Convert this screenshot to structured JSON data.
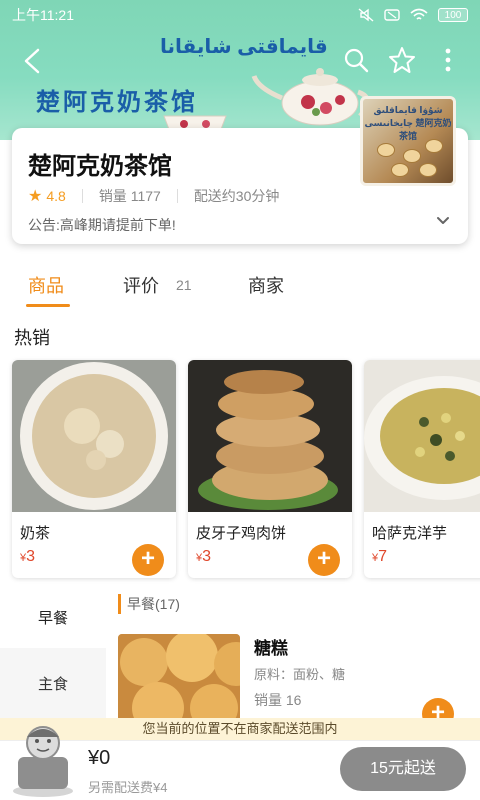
{
  "status_bar": {
    "time": "上午11:21",
    "battery": "100"
  },
  "banner": {
    "uyghur_title": "قايماقتى  شايقانا",
    "cn_title": "楚阿克奶茶馆",
    "thumb_text": "شۇۋا قايماقلىق چايخانىسى 楚阿克奶茶馆"
  },
  "shop": {
    "name": "楚阿克奶茶馆",
    "rating": "4.8",
    "sales": "销量 1177",
    "delivery": "配送约30分钟",
    "notice": "公告:高峰期请提前下单!"
  },
  "tabs": [
    {
      "label": "商品"
    },
    {
      "label": "评价",
      "count": "21"
    },
    {
      "label": "商家"
    }
  ],
  "hot": {
    "title": "热销",
    "items": [
      {
        "name": "奶茶",
        "currency": "¥",
        "price": "3"
      },
      {
        "name": "皮牙子鸡肉饼",
        "currency": "¥",
        "price": "3"
      },
      {
        "name": "哈萨克洋芋",
        "currency": "¥",
        "price": "7"
      }
    ]
  },
  "categories": [
    {
      "label": "早餐"
    },
    {
      "label": "主食"
    }
  ],
  "section": {
    "label": "早餐(17)"
  },
  "food": {
    "name": "糖糕",
    "ingredients": "原料：面粉、糖",
    "sales": "销量 16"
  },
  "range_notice": "您当前的位置不在商家配送范围内",
  "cart": {
    "total": "¥0",
    "fee": "另需配送费¥4",
    "checkout": "15元起送"
  },
  "colors": {
    "accent": "#f08c1a",
    "price": "#e0472b",
    "banner": "#7fd6b6"
  }
}
